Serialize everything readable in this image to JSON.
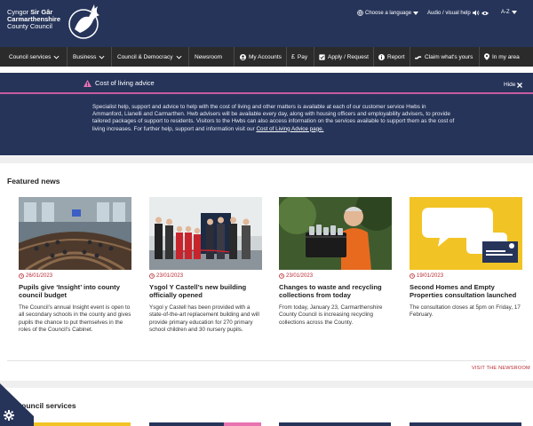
{
  "header": {
    "logo_line1_a": "Cyngor ",
    "logo_line1_b": "Sir Gâr",
    "logo_line2": "Carmarthenshire",
    "logo_line3": "County Council",
    "language": "Choose a language",
    "audio": "Audio / visual help",
    "az": "A-Z"
  },
  "nav": {
    "council_services": "Council services",
    "business": "Business",
    "council_democracy": "Council & Democracy",
    "newsroom": "Newsroom",
    "my_accounts": "My Accounts",
    "pay": "Pay",
    "apply": "Apply / Request",
    "report": "Report",
    "claim": "Claim what's yours",
    "in_my_area": "In my area"
  },
  "cost_of_living": {
    "title": "Cost of living advice",
    "hide": "Hide",
    "body": "Specialist help, support and advice to help with the cost of living and other matters is available at each of our customer service Hwbs in Ammanford, Llanelli and Carmarthen. Hwb advisers will be available every day, along with housing officers and employability advisers, to provide tailored packages of support to residents. Visitors to the Hwbs can also access information on the services available to support them as the cost of living increases. For further help, support and information visit our ",
    "link": "Cost of Living Advice page."
  },
  "featured_news": {
    "heading": "Featured news",
    "cards": [
      {
        "date": "26/01/2023",
        "title": "Pupils give ‘Insight’ into county council budget",
        "desc": "The Council’s annual Insight event is open to all secondary schools in the county and gives pupils the chance to put themselves in the roles of the Council’s Cabinet."
      },
      {
        "date": "23/01/2023",
        "title": "Ysgol Y Castell’s new building officially opened",
        "desc": "Ysgol y Castell has been provided with a state-of-the-art replacement building and will provide primary education for 270 primary school children and 30 nursery pupils."
      },
      {
        "date": "23/01/2023",
        "title": "Changes to waste and recycling collections from today",
        "desc": "From today, January 23, Carmarthenshire County Council is increasing recycling collections across the County."
      },
      {
        "date": "19/01/2023",
        "title": "Second Homes and Empty Properties consultation launched",
        "desc": "The consultation closes at 5pm on Friday, 17 February."
      }
    ],
    "visit_newsroom": "VISIT THE NEWSROOM"
  },
  "council_services": {
    "heading": "Council services"
  },
  "colors": {
    "navy": "#26345a",
    "nav_bg": "#2b2b2b",
    "accent_red": "#b8282f",
    "pink": "#c85b9e"
  }
}
